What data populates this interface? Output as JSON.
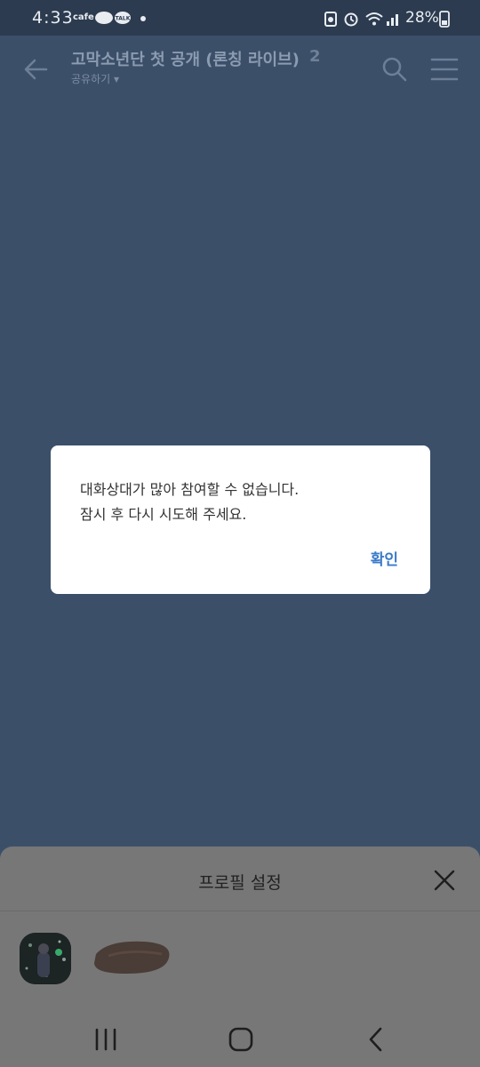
{
  "status_bar": {
    "time": "4:33",
    "cafe_label": "cafe",
    "talk_label": "TALK",
    "battery": "28%"
  },
  "header": {
    "title": "고막소년단 첫 공개 (론칭 라이브)",
    "member_count": "2",
    "share_label": "공유하기 ▾"
  },
  "dialog": {
    "message_line1": "대화상대가 많아 참여할 수 없습니다.",
    "message_line2": "잠시 후 다시 시도해 주세요.",
    "confirm_label": "확인"
  },
  "profile_sheet": {
    "title": "프로필 설정"
  },
  "colors": {
    "background": "#3b4f69",
    "dialog_bg": "#ffffff",
    "accent": "#3a7bc8",
    "sheet_bg": "#777777"
  }
}
